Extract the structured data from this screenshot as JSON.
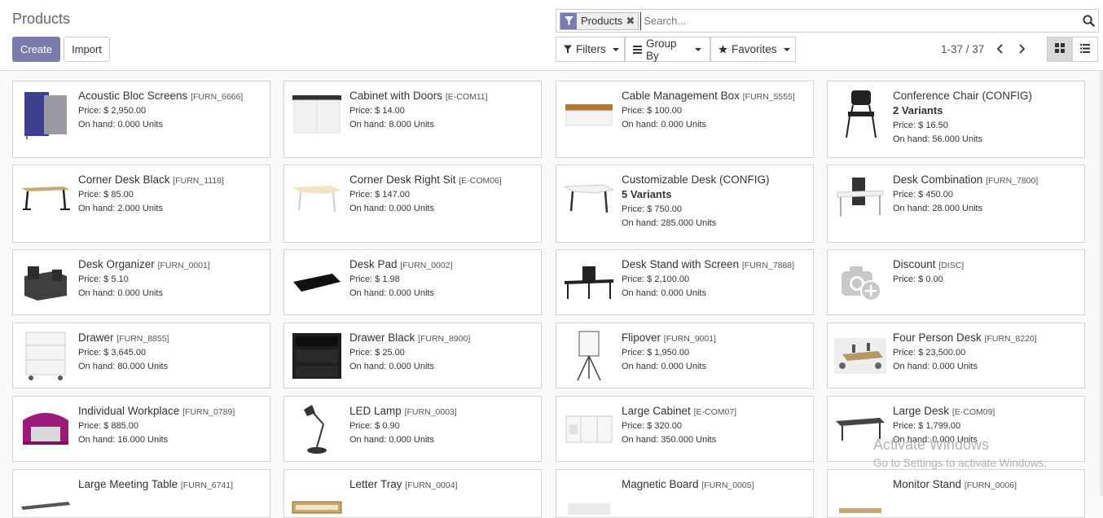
{
  "header": {
    "title": "Products",
    "create_label": "Create",
    "import_label": "Import"
  },
  "search": {
    "facet_label": "Products",
    "facet_icon": "filter-icon",
    "placeholder": "Search..."
  },
  "toolbar": {
    "filters_label": "Filters",
    "group_by_label": "Group By",
    "favorites_label": "Favorites"
  },
  "pager": {
    "value": "1-37 / 37"
  },
  "colors": {
    "primary": "#7c7bad",
    "background": "#f9f9f9",
    "card_border": "#d2d2d2"
  },
  "products": [
    {
      "name": "Acoustic Bloc Screens",
      "code": "[FURN_6666]",
      "price": "Price: $ 2,950.00",
      "on_hand": "On hand: 0.000 Units",
      "variants": "",
      "image": "acoustic-screens-image"
    },
    {
      "name": "Cabinet with Doors",
      "code": "[E-COM11]",
      "price": "Price: $ 14.00",
      "on_hand": "On hand: 8.000 Units",
      "variants": "",
      "image": "cabinet-image"
    },
    {
      "name": "Cable Management Box",
      "code": "[FURN_5555]",
      "price": "Price: $ 100.00",
      "on_hand": "On hand: 0.000 Units",
      "variants": "",
      "image": "cable-box-image"
    },
    {
      "name": "Conference Chair (CONFIG)",
      "code": "",
      "price": "Price: $ 16.50",
      "on_hand": "On hand: 56.000 Units",
      "variants": "2 Variants",
      "image": "chair-image"
    },
    {
      "name": "Corner Desk Black",
      "code": "[FURN_1118]",
      "price": "Price: $ 85.00",
      "on_hand": "On hand: 2.000 Units",
      "variants": "",
      "image": "corner-desk-black-image"
    },
    {
      "name": "Corner Desk Right Sit",
      "code": "[E-COM06]",
      "price": "Price: $ 147.00",
      "on_hand": "On hand: 0.000 Units",
      "variants": "",
      "image": "corner-desk-right-image"
    },
    {
      "name": "Customizable Desk (CONFIG)",
      "code": "",
      "price": "Price: $ 750.00",
      "on_hand": "On hand: 285.000 Units",
      "variants": "5 Variants",
      "image": "custom-desk-image"
    },
    {
      "name": "Desk Combination",
      "code": "[FURN_7800]",
      "price": "Price: $ 450.00",
      "on_hand": "On hand: 28.000 Units",
      "variants": "",
      "image": "desk-combination-image"
    },
    {
      "name": "Desk Organizer",
      "code": "[FURN_0001]",
      "price": "Price: $ 5.10",
      "on_hand": "On hand: 0.000 Units",
      "variants": "",
      "image": "desk-organizer-image"
    },
    {
      "name": "Desk Pad",
      "code": "[FURN_0002]",
      "price": "Price: $ 1.98",
      "on_hand": "On hand: 0.000 Units",
      "variants": "",
      "image": "desk-pad-image"
    },
    {
      "name": "Desk Stand with Screen",
      "code": "[FURN_7888]",
      "price": "Price: $ 2,100.00",
      "on_hand": "On hand: 0.000 Units",
      "variants": "",
      "image": "desk-stand-image"
    },
    {
      "name": "Discount",
      "code": "[DISC]",
      "price": "Price: $ 0.00",
      "on_hand": "",
      "variants": "",
      "image": "placeholder-camera-icon"
    },
    {
      "name": "Drawer",
      "code": "[FURN_8855]",
      "price": "Price: $ 3,645.00",
      "on_hand": "On hand: 80.000 Units",
      "variants": "",
      "image": "drawer-image"
    },
    {
      "name": "Drawer Black",
      "code": "[FURN_8900]",
      "price": "Price: $ 25.00",
      "on_hand": "On hand: 0.000 Units",
      "variants": "",
      "image": "drawer-black-image"
    },
    {
      "name": "Flipover",
      "code": "[FURN_9001]",
      "price": "Price: $ 1,950.00",
      "on_hand": "On hand: 0.000 Units",
      "variants": "",
      "image": "flipover-image"
    },
    {
      "name": "Four Person Desk",
      "code": "[FURN_8220]",
      "price": "Price: $ 23,500.00",
      "on_hand": "On hand: 0.000 Units",
      "variants": "",
      "image": "four-person-desk-image"
    },
    {
      "name": "Individual Workplace",
      "code": "[FURN_0789]",
      "price": "Price: $ 885.00",
      "on_hand": "On hand: 16.000 Units",
      "variants": "",
      "image": "workplace-pod-image"
    },
    {
      "name": "LED Lamp",
      "code": "[FURN_0003]",
      "price": "Price: $ 0.90",
      "on_hand": "On hand: 0.000 Units",
      "variants": "",
      "image": "lamp-image"
    },
    {
      "name": "Large Cabinet",
      "code": "[E-COM07]",
      "price": "Price: $ 320.00",
      "on_hand": "On hand: 350.000 Units",
      "variants": "",
      "image": "large-cabinet-image"
    },
    {
      "name": "Large Desk",
      "code": "[E-COM09]",
      "price": "Price: $ 1,799.00",
      "on_hand": "On hand: 0.000 Units",
      "variants": "",
      "image": "large-desk-image"
    },
    {
      "name": "Large Meeting Table",
      "code": "[FURN_6741]",
      "price": "",
      "on_hand": "",
      "variants": "",
      "image": "meeting-table-image"
    },
    {
      "name": "Letter Tray",
      "code": "[FURN_0004]",
      "price": "",
      "on_hand": "",
      "variants": "",
      "image": "letter-tray-image"
    },
    {
      "name": "Magnetic Board",
      "code": "[FURN_0005]",
      "price": "",
      "on_hand": "",
      "variants": "",
      "image": "magnetic-board-image"
    },
    {
      "name": "Monitor Stand",
      "code": "[FURN_0006]",
      "price": "",
      "on_hand": "",
      "variants": "",
      "image": "monitor-stand-image"
    }
  ],
  "watermark": {
    "line1": "Activate Windows",
    "line2": "Go to Settings to activate Windows."
  }
}
